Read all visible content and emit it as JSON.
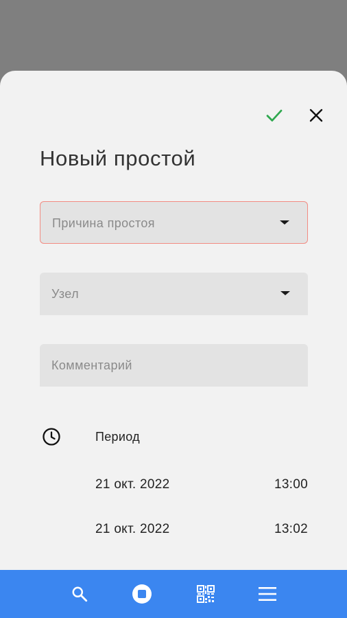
{
  "header": {
    "confirm_icon": "check-icon",
    "close_icon": "close-icon",
    "title": "Новый простой"
  },
  "form": {
    "reason": {
      "label": "Причина простоя",
      "state": "error"
    },
    "node": {
      "label": "Узел"
    },
    "comment": {
      "label": "Комментарий"
    }
  },
  "period": {
    "label": "Период",
    "start": {
      "date": "21 окт. 2022",
      "time": "13:00"
    },
    "end": {
      "date": "21 окт. 2022",
      "time": "13:02"
    }
  },
  "bottom_nav": {
    "items": [
      "search-icon",
      "stop-icon",
      "qr-code-icon",
      "menu-icon"
    ]
  },
  "colors": {
    "accent": "#3b86f0",
    "confirm": "#2fa84f",
    "error_border": "#f28b82"
  }
}
